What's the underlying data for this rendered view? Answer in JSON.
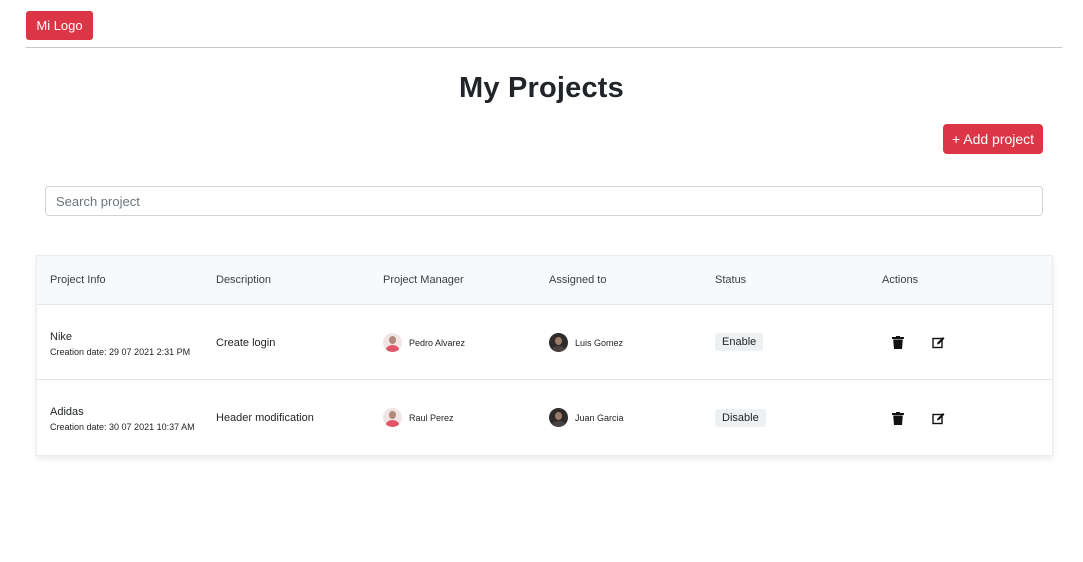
{
  "header": {
    "logo_label": "Mi Logo"
  },
  "page": {
    "title": "My Projects",
    "add_button_label": "+ Add project"
  },
  "search": {
    "placeholder": "Search project",
    "value": ""
  },
  "table": {
    "columns": [
      "Project Info",
      "Description",
      "Project Manager",
      "Assigned to",
      "Status",
      "Actions"
    ],
    "rows": [
      {
        "name": "Nike",
        "creation_date": "Creation date: 29 07 2021 2:31 PM",
        "description": "Create login",
        "manager": "Pedro Alvarez",
        "assigned": "Luis Gomez",
        "status": "Enable"
      },
      {
        "name": "Adidas",
        "creation_date": "Creation date: 30 07 2021 10:37 AM",
        "description": "Header modification",
        "manager": "Raul Perez",
        "assigned": "Juan Garcia",
        "status": "Disable"
      }
    ]
  },
  "colors": {
    "accent": "#dc3545",
    "badge_bg": "#eef1f4",
    "header_bg": "#f8f9fa"
  },
  "icons": {
    "delete": "trash-icon",
    "edit": "edit-icon"
  }
}
